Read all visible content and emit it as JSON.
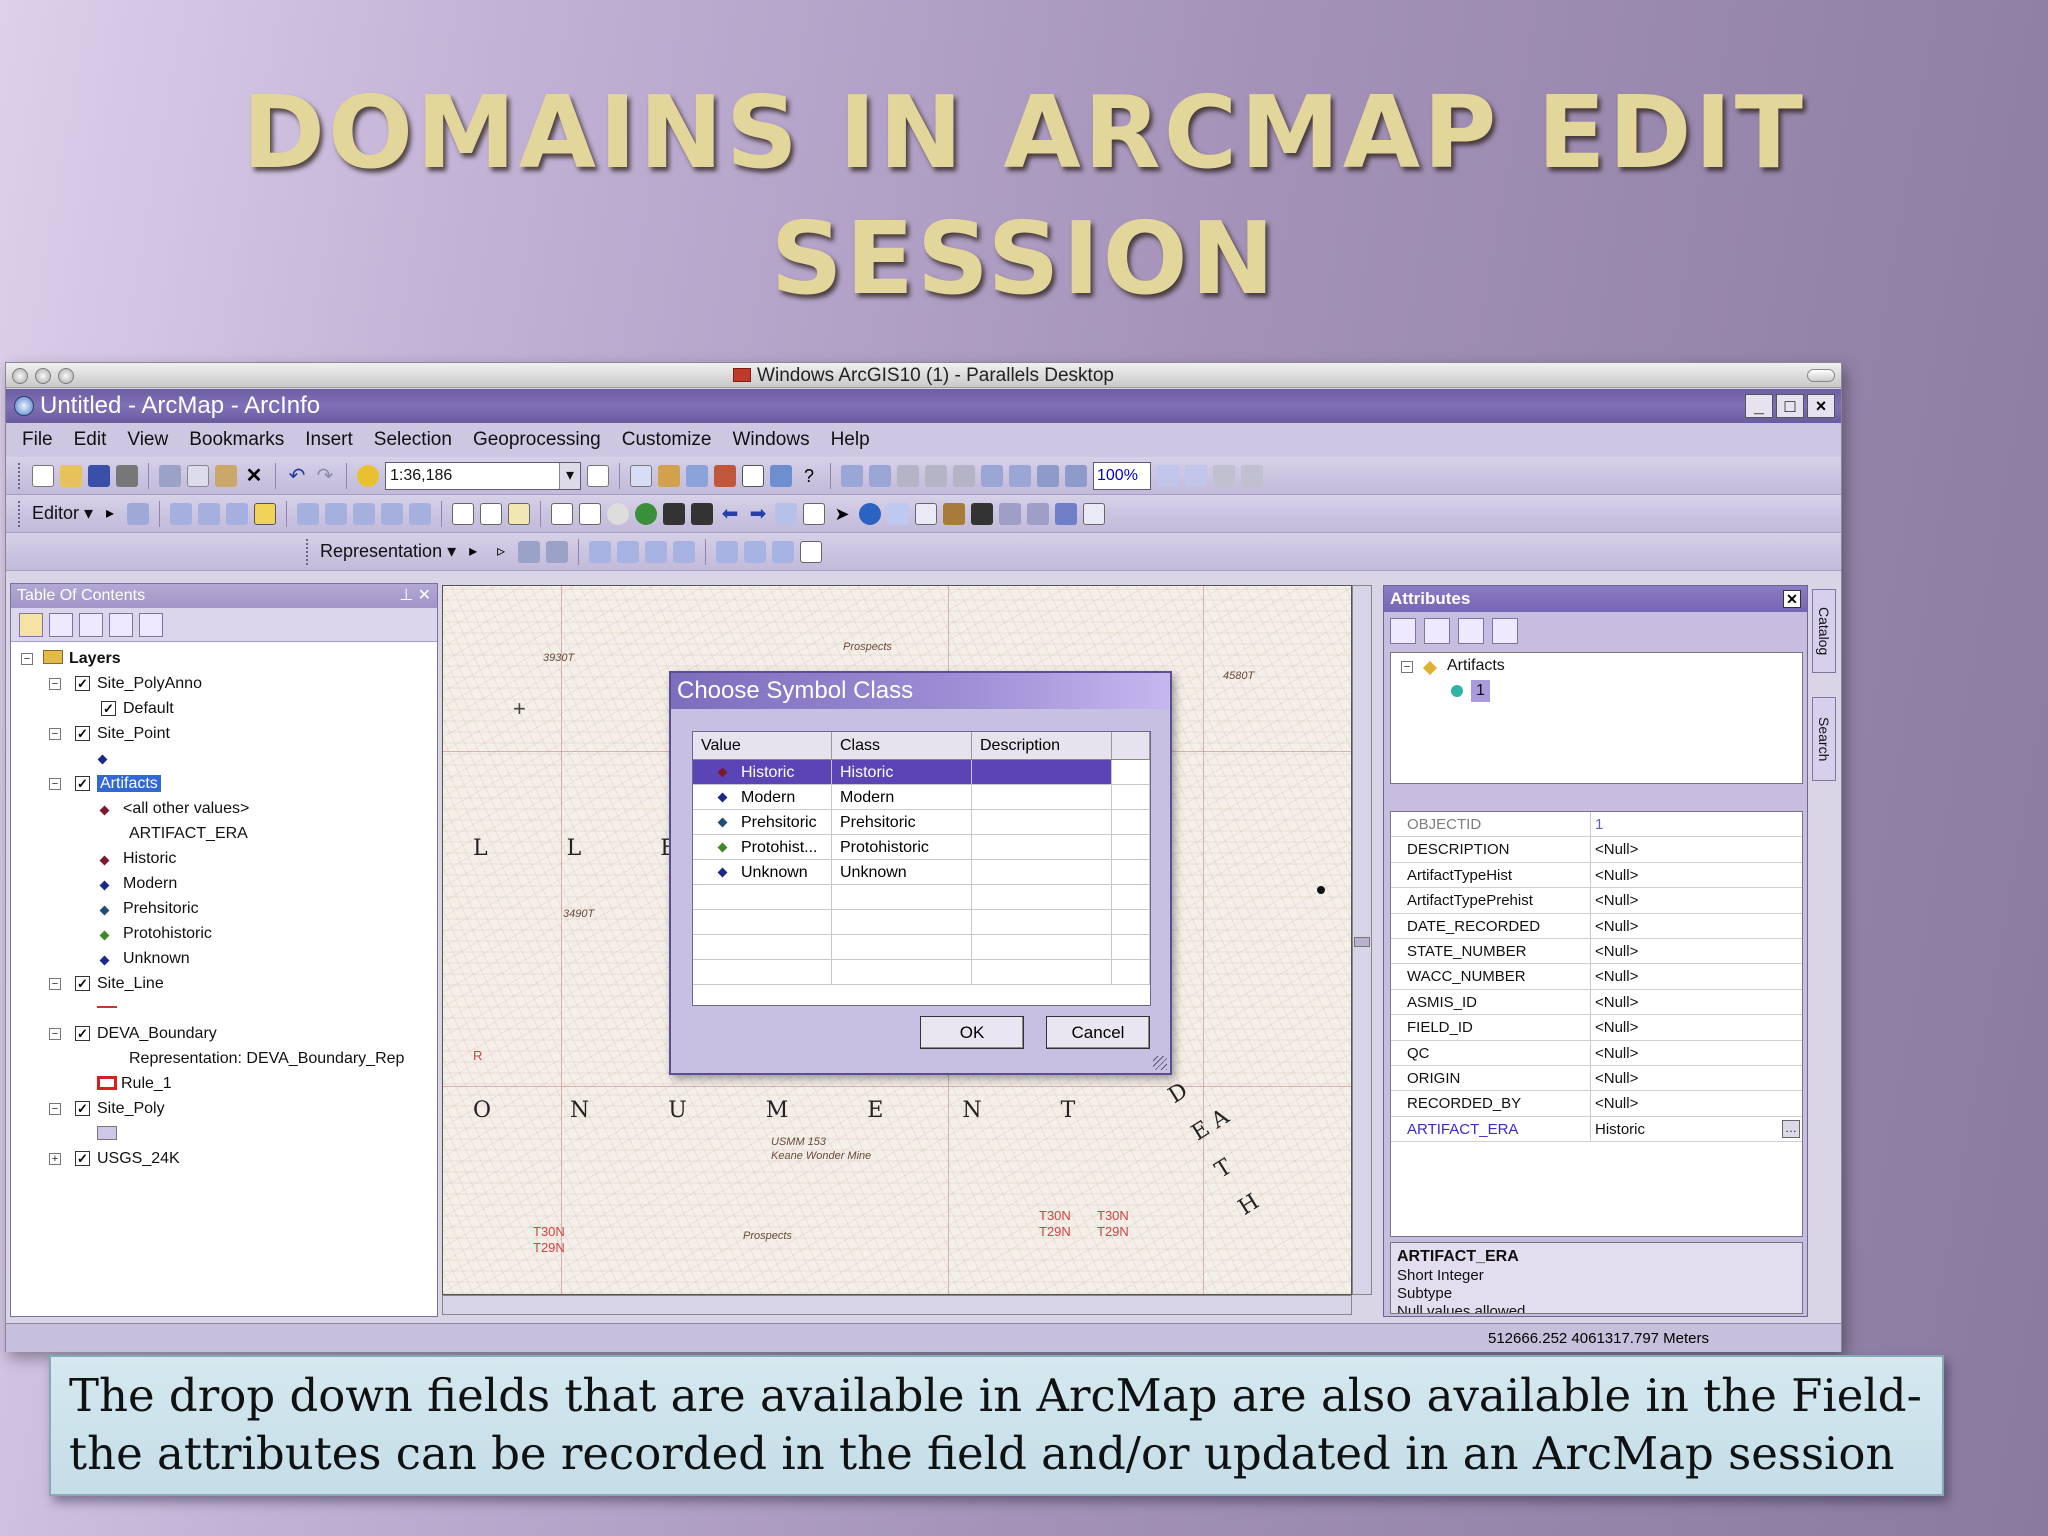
{
  "slide": {
    "title_line1": "DOMAINS IN ARCMAP EDIT",
    "title_line2": "SESSION",
    "caption_line1": "The drop down fields that are available in ArcMap are also available in the Field-",
    "caption_line2": "the attributes can be recorded in the field and/or updated in an ArcMap session"
  },
  "host_window": {
    "title": "Windows ArcGIS10 (1) - Parallels Desktop"
  },
  "app": {
    "title": "Untitled - ArcMap - ArcInfo"
  },
  "menu": [
    "File",
    "Edit",
    "View",
    "Bookmarks",
    "Insert",
    "Selection",
    "Geoprocessing",
    "Customize",
    "Windows",
    "Help"
  ],
  "toolbar": {
    "scale": "1:36,186",
    "zoom_percent": "100%",
    "editor_label": "Editor ▾",
    "representation_label": "Representation ▾"
  },
  "toc": {
    "title": "Table Of Contents",
    "root": "Layers",
    "site_polyanno": "Site_PolyAnno",
    "default": "Default",
    "site_point": "Site_Point",
    "artifacts": "Artifacts",
    "all_other_values": "<all other values>",
    "artifact_era": "ARTIFACT_ERA",
    "historic": "Historic",
    "modern": "Modern",
    "prehsitoric": "Prehsitoric",
    "protohistoric": "Protohistoric",
    "unknown": "Unknown",
    "site_line": "Site_Line",
    "deva_boundary": "DEVA_Boundary",
    "representation": "Representation: DEVA_Boundary_Rep",
    "rule_1": "Rule_1",
    "site_poly": "Site_Poly",
    "usgs_24k": "USGS_24K"
  },
  "map": {
    "label_lley": "L L E Y",
    "label_onument": "O N U M E N T",
    "label_death": "D E A T H",
    "contour_3930": "3930T",
    "contour_4580": "4580T",
    "contour_3490": "3490T",
    "prospects": "Prospects",
    "t30n_1": "T30N",
    "t29n_1": "T29N",
    "t30n_2": "T30N",
    "t29n_2": "T29N",
    "t30n_3": "T30N",
    "t29n_3": "T29N",
    "r": "R",
    "usmm": "USMM 153",
    "keane": "Keane Wonder Mine",
    "prospects2": "Prospects"
  },
  "dialog": {
    "title": "Choose Symbol Class",
    "col_value": "Value",
    "col_class": "Class",
    "col_description": "Description",
    "rows": [
      {
        "value": "Historic",
        "class": "Historic",
        "description": ""
      },
      {
        "value": "Modern",
        "class": "Modern",
        "description": ""
      },
      {
        "value": "Prehsitoric",
        "class": "Prehsitoric",
        "description": ""
      },
      {
        "value": "Protohist...",
        "class": "Protohistoric",
        "description": ""
      },
      {
        "value": "Unknown",
        "class": "Unknown",
        "description": ""
      }
    ],
    "ok": "OK",
    "cancel": "Cancel"
  },
  "attributes": {
    "title": "Attributes",
    "tree_layer": "Artifacts",
    "tree_feature": "1",
    "fields": [
      {
        "name": "OBJECTID",
        "value": "1"
      },
      {
        "name": "DESCRIPTION",
        "value": "<Null>"
      },
      {
        "name": "ArtifactTypeHist",
        "value": "<Null>"
      },
      {
        "name": "ArtifactTypePrehist",
        "value": "<Null>"
      },
      {
        "name": "DATE_RECORDED",
        "value": "<Null>"
      },
      {
        "name": "STATE_NUMBER",
        "value": "<Null>"
      },
      {
        "name": "WACC_NUMBER",
        "value": "<Null>"
      },
      {
        "name": "ASMIS_ID",
        "value": "<Null>"
      },
      {
        "name": "FIELD_ID",
        "value": "<Null>"
      },
      {
        "name": "QC",
        "value": "<Null>"
      },
      {
        "name": "ORIGIN",
        "value": "<Null>"
      },
      {
        "name": "RECORDED_BY",
        "value": "<Null>"
      },
      {
        "name": "ARTIFACT_ERA",
        "value": "Historic"
      }
    ],
    "info_title": "ARTIFACT_ERA",
    "info_line1": "Short Integer",
    "info_line2": "Subtype",
    "info_line3": "Null values allowed"
  },
  "side_tabs": {
    "catalog": "Catalog",
    "search": "Search"
  },
  "status": {
    "coordinates": "512666.252  4061317.797 Meters"
  },
  "colors": {
    "historic": "#7a1a2a",
    "modern": "#1b2a8a",
    "prehistoric": "#1d4f7a",
    "protohistoric": "#3d8a24",
    "unknown": "#1b2a8a"
  }
}
